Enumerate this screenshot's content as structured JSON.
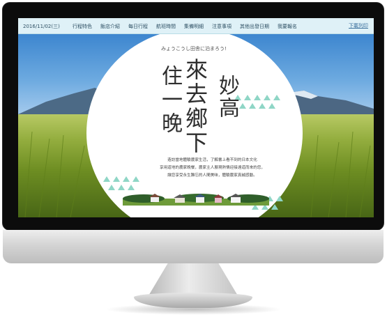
{
  "navbar": {
    "date": "2016/11/02(三)",
    "items": [
      "行程特色",
      "飯店介紹",
      "每日行程",
      "航班時間",
      "集備明細",
      "注意事項",
      "其他出發日期",
      "我要報名"
    ],
    "login": "下載列印"
  },
  "hero": {
    "tagline": "みょうこうし田舎に泊まろう!",
    "place": "妙高",
    "title": "來去鄉下",
    "stay": "住一晚",
    "description": [
      "造訪當地體驗農家生活，了解書上看不到的日本文化",
      "享用道地的農家晚餐，農家主人展現熱情迎接遠道而來的您，",
      "讓您享受永生難忘的人間美味，體驗農家真誠感動。"
    ]
  },
  "colors": {
    "nav_bg": "#dff1f7",
    "accent": "#7fcfc0"
  }
}
